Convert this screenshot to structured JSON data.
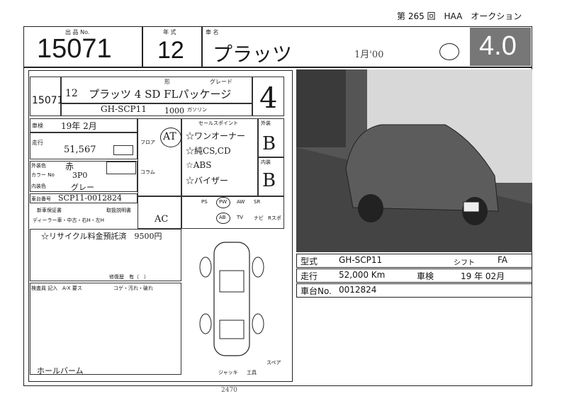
{
  "header": {
    "session": "第 265 回　HAA　オークション"
  },
  "top": {
    "lot_label": "出 品 No.",
    "lot": "15071",
    "year_label": "年 式",
    "year": "12",
    "name_label": "車 名",
    "name": "プラッツ",
    "hand_note": "1月'00",
    "grade": "4.0"
  },
  "sheet": {
    "lot_small": "15071",
    "year_small": "12",
    "model_hand": "プラッツ 4 SD FLパッケージ",
    "form_label": "形",
    "grade_label": "グレード",
    "model_code": "GH-SCP11",
    "cc": "1000",
    "fuel": "ガソリン",
    "score_hand": "4",
    "inspection_label": "車検",
    "inspection_value": "19年 2月",
    "mileage_label": "走行",
    "mileage_value": "51,567",
    "color_label": "外装色",
    "color_value": "赤",
    "color_code_label": "カラー No",
    "color_code_value": "3P0",
    "interior_label": "内装色",
    "interior_value": "グレー",
    "chassis_label": "車台番号",
    "chassis_value": "SCP11-0012824",
    "new_car_warranty": "新車保証書",
    "manual": "取扱説明書",
    "dealer": "ディーラー車・中古・右H・左H",
    "recycle": "☆リサイクル料金預託済　9500円",
    "repair": "修復歴　有（　）",
    "at": "AT",
    "floor": "フロア",
    "column": "コラム",
    "sales_point_label": "セールスポイント",
    "points": [
      "☆ワンオーナー",
      "☆純CS,CD",
      "☆ABS",
      "☆バイザー"
    ],
    "ext_label": "外装",
    "int_label": "内装",
    "ext_grade": "B",
    "int_grade": "B",
    "ac": "AC",
    "equip": [
      "PS",
      "PW",
      "AW",
      "SR",
      "AB",
      "TV",
      "ナビ",
      "Rスポ"
    ],
    "inspector_label": "検査員 記入",
    "marks": "A-X 要ス",
    "marks2": "コゲ・汚れ・破れ",
    "signature": "ホールバーム",
    "jack": "ジャッキ",
    "tools": "工具",
    "spare": "スペア",
    "bottom_note": "2470"
  },
  "info": {
    "type_label": "型式",
    "type_value": "GH-SCP11",
    "shift_label": "シフト",
    "shift_value": "FA",
    "mileage_label": "走行",
    "mileage_value": "52,000 Km",
    "inspect_label": "車検",
    "inspect_value": "19 年 02月",
    "chassis_label": "車台No.",
    "chassis_value": "0012824"
  }
}
